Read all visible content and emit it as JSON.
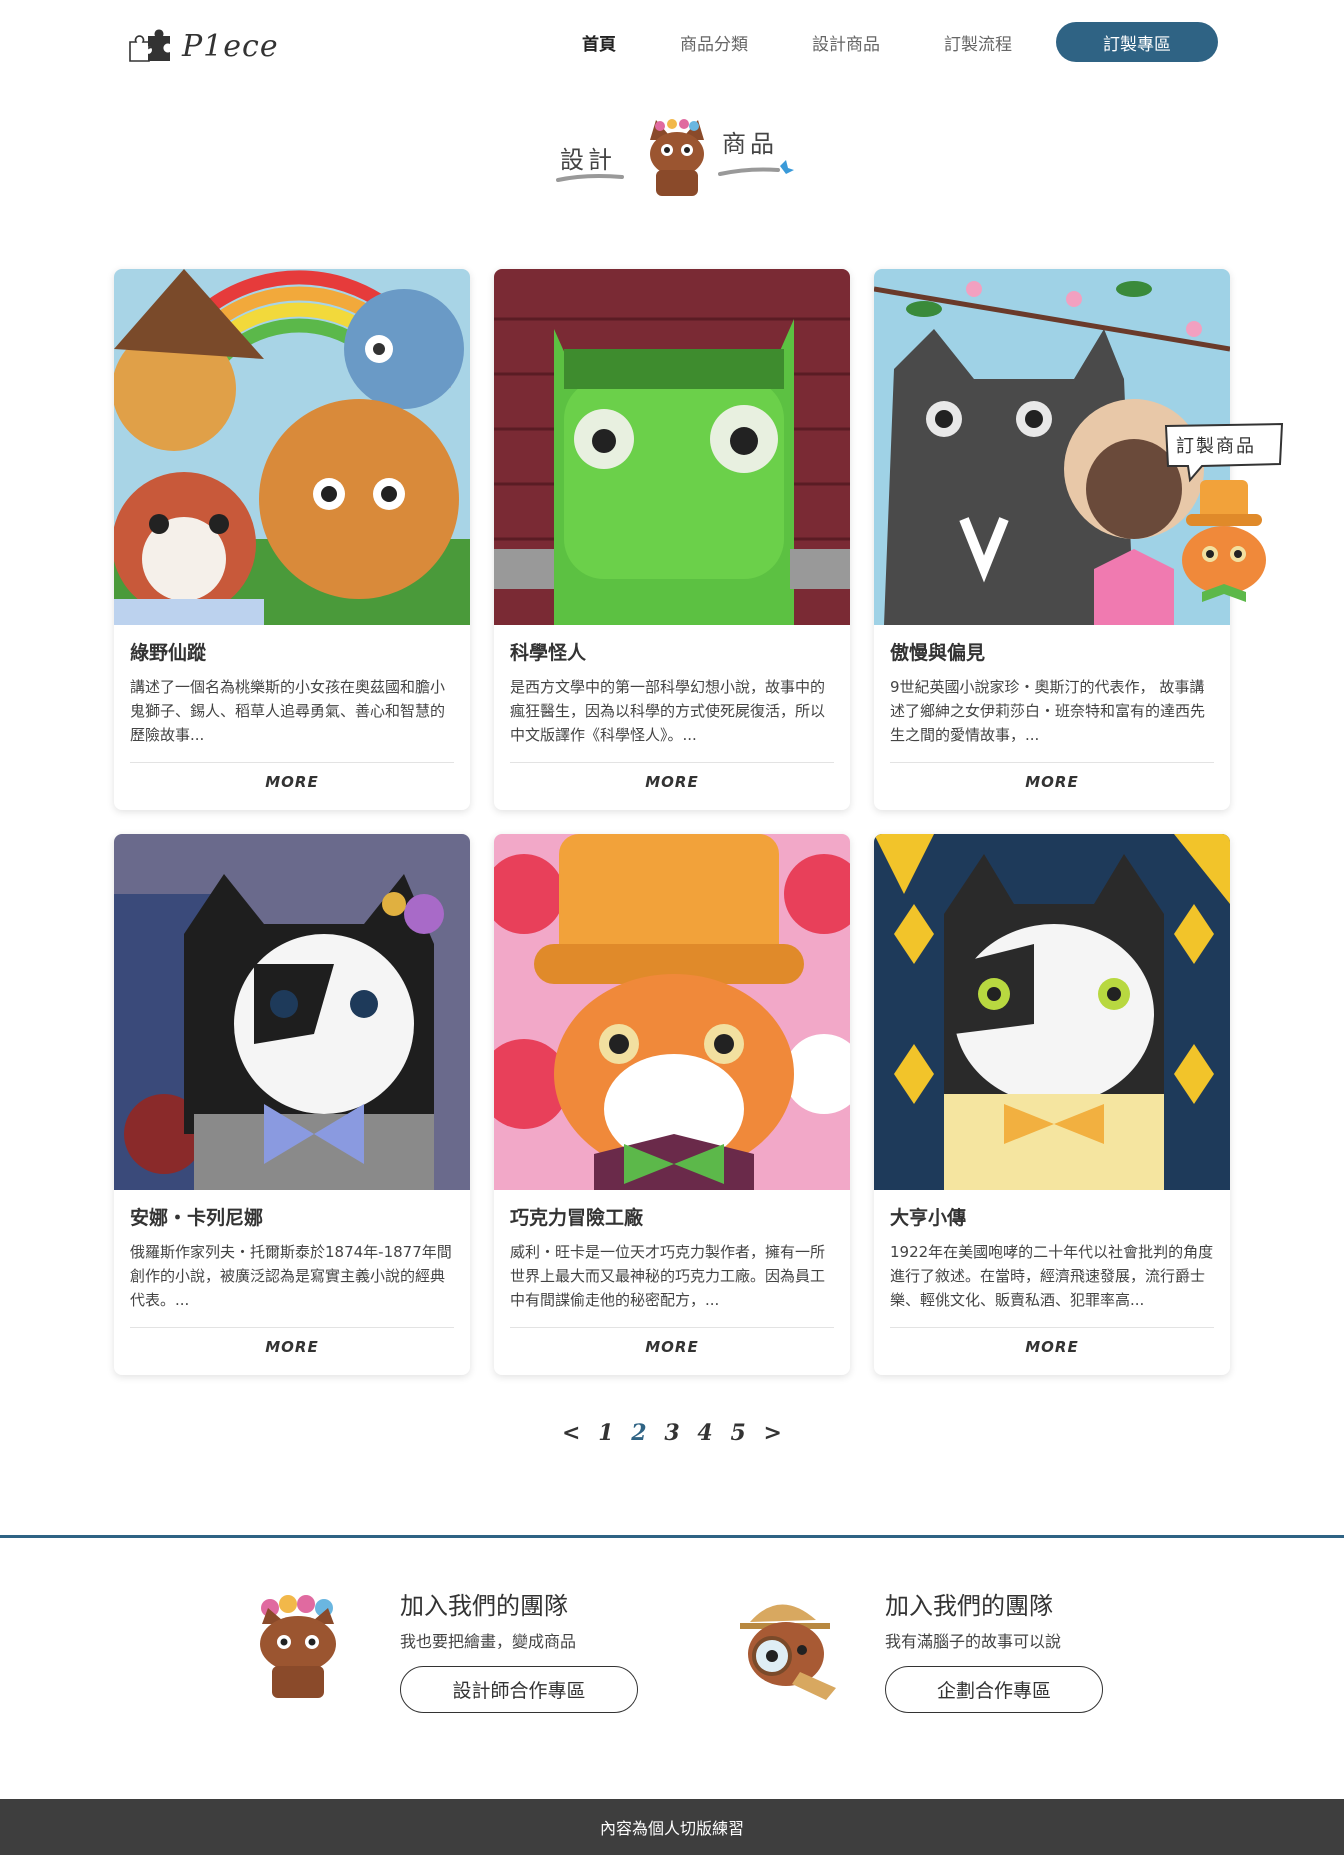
{
  "header": {
    "logo_text": "P1ece",
    "nav": [
      "首頁",
      "商品分類",
      "設計商品",
      "訂製流程"
    ],
    "cta": "訂製專區"
  },
  "section_title": {
    "left": "設計",
    "right": "商品"
  },
  "callout": "訂製商品",
  "cards": [
    {
      "title": "綠野仙蹤",
      "desc": "講述了一個名為桃樂斯的小女孩在奧茲國和膽小鬼獅子、錫人、稻草人追尋勇氣、善心和智慧的歷險故事...",
      "more": "MORE"
    },
    {
      "title": "科學怪人",
      "desc": "是西方文學中的第一部科學幻想小說，故事中的瘋狂醫生，因為以科學的方式使死屍復活，所以中文版譯作《科學怪人》。...",
      "more": "MORE"
    },
    {
      "title": "傲慢與偏見",
      "desc": "9世紀英國小說家珍・奧斯汀的代表作， 故事講述了鄉紳之女伊莉莎白・班奈特和富有的達西先生之間的愛情故事，...",
      "more": "MORE"
    },
    {
      "title": "安娜・卡列尼娜",
      "desc": "俄羅斯作家列夫・托爾斯泰於1874年-1877年間創作的小說，被廣泛認為是寫實主義小說的經典代表。...",
      "more": "MORE"
    },
    {
      "title": "巧克力冒險工廠",
      "desc": "威利・旺卡是一位天才巧克力製作者，擁有一所世界上最大而又最神秘的巧克力工廠。因為員工中有間諜偷走他的秘密配方，...",
      "more": "MORE"
    },
    {
      "title": "大亨小傳",
      "desc": "1922年在美國咆哮的二十年代以社會批判的角度進行了敘述。在當時，經濟飛速發展，流行爵士樂、輕佻文化、販賣私酒、犯罪率高...",
      "more": "MORE"
    }
  ],
  "pagination": {
    "prev": "<",
    "pages": [
      "1",
      "2",
      "3",
      "4",
      "5"
    ],
    "current": "2",
    "next": ">"
  },
  "team": [
    {
      "title": "加入我們的團隊",
      "subtitle": "我也要把繪畫，變成商品",
      "button": "設計師合作專區"
    },
    {
      "title": "加入我們的團隊",
      "subtitle": "我有滿腦子的故事可以說",
      "button": "企劃合作專區"
    }
  ],
  "footer": "內容為個人切版練習",
  "colors": {
    "accent": "#2f6384",
    "footer_bg": "#3e3e3e"
  }
}
